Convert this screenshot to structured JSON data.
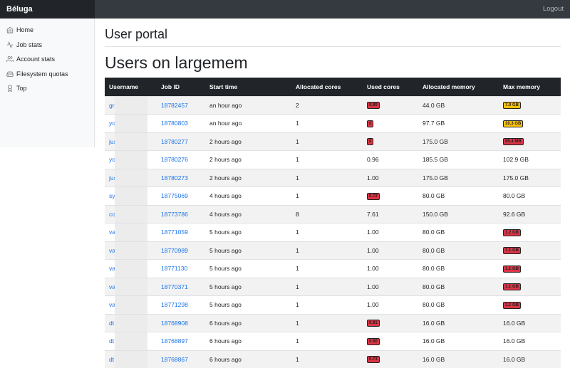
{
  "navbar": {
    "brand": "Béluga",
    "logout": "Logout"
  },
  "sidebar": {
    "items": [
      {
        "label": "Home",
        "icon": "home-icon"
      },
      {
        "label": "Job stats",
        "icon": "activity-icon"
      },
      {
        "label": "Account stats",
        "icon": "users-icon"
      },
      {
        "label": "Filesystem quotas",
        "icon": "hard-drive-icon"
      },
      {
        "label": "Top",
        "icon": "award-icon"
      }
    ]
  },
  "main": {
    "portal_title": "User portal",
    "page_title": "Users on largemem",
    "table": {
      "headers": [
        "Username",
        "Job ID",
        "Start time",
        "Allocated cores",
        "Used cores",
        "Allocated memory",
        "Max memory"
      ],
      "rows": [
        {
          "username": "gr",
          "job_id": "18782457",
          "start": "an hour ago",
          "alloc_cores": "2",
          "used_cores": "0.99",
          "used_cores_badge": "red",
          "alloc_mem": "44.0 GB",
          "max_mem": "7.0 GB",
          "max_mem_badge": "yellow"
        },
        {
          "username": "yo",
          "job_id": "18780803",
          "start": "an hour ago",
          "alloc_cores": "1",
          "used_cores": "0",
          "used_cores_badge": "red",
          "alloc_mem": "97.7 GB",
          "max_mem": "10.3 GB",
          "max_mem_badge": "yellow"
        },
        {
          "username": "jus",
          "job_id": "18780277",
          "start": "2 hours ago",
          "alloc_cores": "1",
          "used_cores": "0",
          "used_cores_badge": "red",
          "alloc_mem": "175.0 GB",
          "max_mem": "85.4 MB",
          "max_mem_badge": "red"
        },
        {
          "username": "yo",
          "job_id": "18780276",
          "start": "2 hours ago",
          "alloc_cores": "1",
          "used_cores": "0.96",
          "used_cores_badge": "",
          "alloc_mem": "185.5 GB",
          "max_mem": "102.9 GB",
          "max_mem_badge": ""
        },
        {
          "username": "jus",
          "job_id": "18780273",
          "start": "2 hours ago",
          "alloc_cores": "1",
          "used_cores": "1.00",
          "used_cores_badge": "",
          "alloc_mem": "175.0 GB",
          "max_mem": "175.0 GB",
          "max_mem_badge": ""
        },
        {
          "username": "sy",
          "job_id": "18775069",
          "start": "4 hours ago",
          "alloc_cores": "1",
          "used_cores": "0.72",
          "used_cores_badge": "red",
          "alloc_mem": "80.0 GB",
          "max_mem": "80.0 GB",
          "max_mem_badge": ""
        },
        {
          "username": "co",
          "job_id": "18773786",
          "start": "4 hours ago",
          "alloc_cores": "8",
          "used_cores": "7.61",
          "used_cores_badge": "",
          "alloc_mem": "150.0 GB",
          "max_mem": "92.6 GB",
          "max_mem_badge": ""
        },
        {
          "username": "va",
          "job_id": "18771059",
          "start": "5 hours ago",
          "alloc_cores": "1",
          "used_cores": "1.00",
          "used_cores_badge": "",
          "alloc_mem": "80.0 GB",
          "max_mem": "1.2 GB",
          "max_mem_badge": "red"
        },
        {
          "username": "va",
          "job_id": "18770989",
          "start": "5 hours ago",
          "alloc_cores": "1",
          "used_cores": "1.00",
          "used_cores_badge": "",
          "alloc_mem": "80.0 GB",
          "max_mem": "1.1 GB",
          "max_mem_badge": "red"
        },
        {
          "username": "va",
          "job_id": "18771130",
          "start": "5 hours ago",
          "alloc_cores": "1",
          "used_cores": "1.00",
          "used_cores_badge": "",
          "alloc_mem": "80.0 GB",
          "max_mem": "1.1 GB",
          "max_mem_badge": "red"
        },
        {
          "username": "va",
          "job_id": "18770371",
          "start": "5 hours ago",
          "alloc_cores": "1",
          "used_cores": "1.00",
          "used_cores_badge": "",
          "alloc_mem": "80.0 GB",
          "max_mem": "1.1 GB",
          "max_mem_badge": "red"
        },
        {
          "username": "va",
          "job_id": "18771298",
          "start": "5 hours ago",
          "alloc_cores": "1",
          "used_cores": "1.00",
          "used_cores_badge": "",
          "alloc_mem": "80.0 GB",
          "max_mem": "1.1 GB",
          "max_mem_badge": "red"
        },
        {
          "username": "dt",
          "job_id": "18768908",
          "start": "6 hours ago",
          "alloc_cores": "1",
          "used_cores": "0.81",
          "used_cores_badge": "red",
          "alloc_mem": "16.0 GB",
          "max_mem": "16.0 GB",
          "max_mem_badge": ""
        },
        {
          "username": "dt",
          "job_id": "18768897",
          "start": "6 hours ago",
          "alloc_cores": "1",
          "used_cores": "0.80",
          "used_cores_badge": "red",
          "alloc_mem": "16.0 GB",
          "max_mem": "16.0 GB",
          "max_mem_badge": ""
        },
        {
          "username": "dt",
          "job_id": "18768867",
          "start": "6 hours ago",
          "alloc_cores": "1",
          "used_cores": "0.73",
          "used_cores_badge": "red",
          "alloc_mem": "16.0 GB",
          "max_mem": "16.0 GB",
          "max_mem_badge": ""
        }
      ]
    }
  },
  "colors": {
    "navbar_bg": "#343a40",
    "brand_bg": "#212529",
    "link": "#1a73e8",
    "badge_red": "#dc3545",
    "badge_yellow": "#ffc107",
    "stripe": "#f2f2f2"
  }
}
